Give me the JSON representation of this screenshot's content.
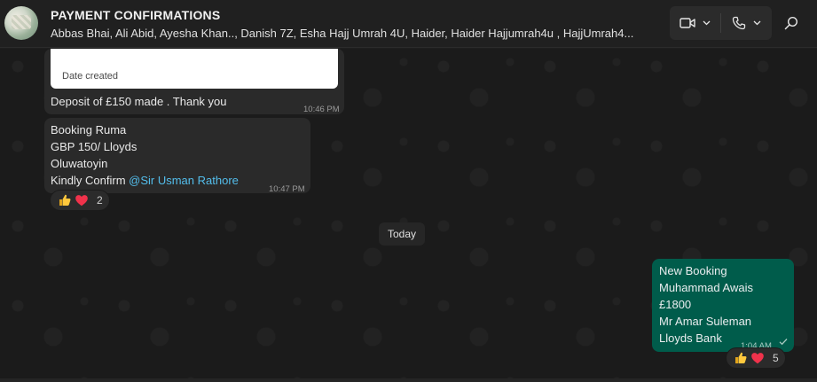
{
  "header": {
    "title": "PAYMENT CONFIRMATIONS",
    "members": "Abbas Bhai, Ali Abid, Ayesha Khan.., Danish 7Z, Esha Hajj Umrah 4U, Haider, Haider Hajjumrah4u , HajjUmrah4..."
  },
  "messages": {
    "deposit": {
      "image_caption": "Date created",
      "text": "Deposit of £150 made . Thank you",
      "time": "10:46 PM"
    },
    "booking_ruma": {
      "line1": "Booking Ruma",
      "line2": "GBP 150/ Lloyds",
      "line3": "Oluwatoyin",
      "line4_prefix": "Kindly Confirm ",
      "mention": "@Sir Usman Rathore",
      "time": "10:47 PM",
      "reactions": {
        "icons": [
          "thumbs-up",
          "red-heart"
        ],
        "count": "2"
      }
    },
    "date_separator": "Today",
    "new_booking": {
      "line1": "New Booking",
      "line2": "Muhammad Awais",
      "line3": "£1800",
      "line4": "Mr Amar Suleman",
      "line5": "Lloyds Bank",
      "time": "1:04 AM",
      "status": "sent-check",
      "reactions": {
        "icons": [
          "thumbs-up",
          "red-heart"
        ],
        "count": "5"
      }
    }
  },
  "colors": {
    "incoming_bubble": "#2a2a2a",
    "outgoing_bubble": "#005c4b",
    "mention": "#53bdeb",
    "background": "#1b1b1b"
  }
}
